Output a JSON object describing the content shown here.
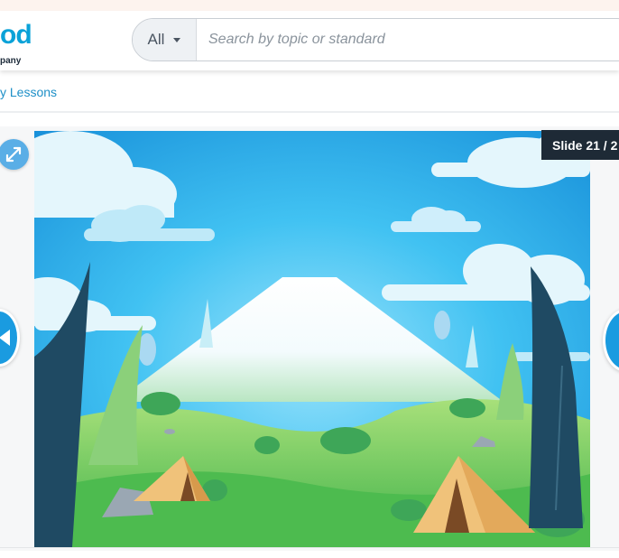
{
  "header": {
    "logo_text": "od",
    "logo_subtext": "pany",
    "search": {
      "scope_selected": "All",
      "placeholder": "Search by topic or standard",
      "value": ""
    }
  },
  "breadcrumb": {
    "label": "y Lessons"
  },
  "slideshow": {
    "counter": "Slide 21 / 2",
    "slide_image": "camping-landscape-illustration"
  },
  "icons": {
    "expand": "expand-icon",
    "prev": "triangle-left-icon",
    "caret": "chevron-down-icon"
  },
  "colors": {
    "accent": "#1a9be0",
    "link": "#1d8fc7",
    "counter_bg": "#1e2a36",
    "sky": "#2fb2ea"
  }
}
